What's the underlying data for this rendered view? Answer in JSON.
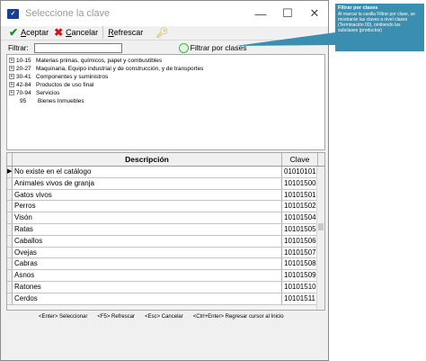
{
  "window": {
    "title": "Seleccione la clave"
  },
  "toolbar": {
    "accept_prefix": "",
    "accept_rest": "ceptar",
    "accept_u": "A",
    "cancel_u": "C",
    "cancel_rest": "ancelar",
    "refresh_u": "R",
    "refresh_rest": "efrescar"
  },
  "filter": {
    "label": "Filtrar:",
    "value": "",
    "checkbox_label": "Filtrar por clases"
  },
  "tree": {
    "items": [
      {
        "code": "10-15",
        "label": "Materias primas, químicos, papel y combustibles"
      },
      {
        "code": "20-27",
        "label": "Maquinaria, Equipo industrial y de construcción, y de transportes"
      },
      {
        "code": "30-41",
        "label": "Componentes y suministros"
      },
      {
        "code": "42-84",
        "label": "Productos de uso final"
      },
      {
        "code": "70-94",
        "label": "Servicios"
      },
      {
        "code": "95",
        "label": "Bienes Inmuebles"
      }
    ]
  },
  "grid": {
    "headers": {
      "description": "Descripción",
      "clave": "Clave"
    },
    "rows": [
      {
        "description": "No existe en el catálogo",
        "clave": "01010101"
      },
      {
        "description": "Animales vivos de granja",
        "clave": "10101500"
      },
      {
        "description": "Gatos vivos",
        "clave": "10101501"
      },
      {
        "description": "Perros",
        "clave": "10101502"
      },
      {
        "description": "Visón",
        "clave": "10101504"
      },
      {
        "description": "Ratas",
        "clave": "10101505"
      },
      {
        "description": "Caballos",
        "clave": "10101506"
      },
      {
        "description": "Ovejas",
        "clave": "10101507"
      },
      {
        "description": "Cabras",
        "clave": "10101508"
      },
      {
        "description": "Asnos",
        "clave": "10101509"
      },
      {
        "description": "Ratones",
        "clave": "10101510"
      },
      {
        "description": "Cerdos",
        "clave": "10101511"
      }
    ]
  },
  "statusbar": {
    "hints": [
      "<Enter> Seleccionar",
      "<F5> Refrescar",
      "<Esc> Cancelar",
      "<Ctrl+Enter> Regresar cursor al Inicio"
    ]
  },
  "tooltip": {
    "title": "Filtrar por clases",
    "text": "Al marcar la casilla Filtrar por clase, se mostrarán las claves a nivel clases (Terminación 00), omitiendo las subclases (productos)"
  },
  "colors": {
    "tooltip_bg": "#3a8fb0",
    "accept_icon": "#1e8a2d",
    "cancel_icon": "#c91a1a"
  },
  "icons": {
    "app": "app-icon",
    "accept": "check-icon",
    "cancel": "x-icon",
    "key": "key-icon",
    "minimize": "minimize-icon",
    "maximize": "maximize-icon",
    "close": "close-icon"
  }
}
